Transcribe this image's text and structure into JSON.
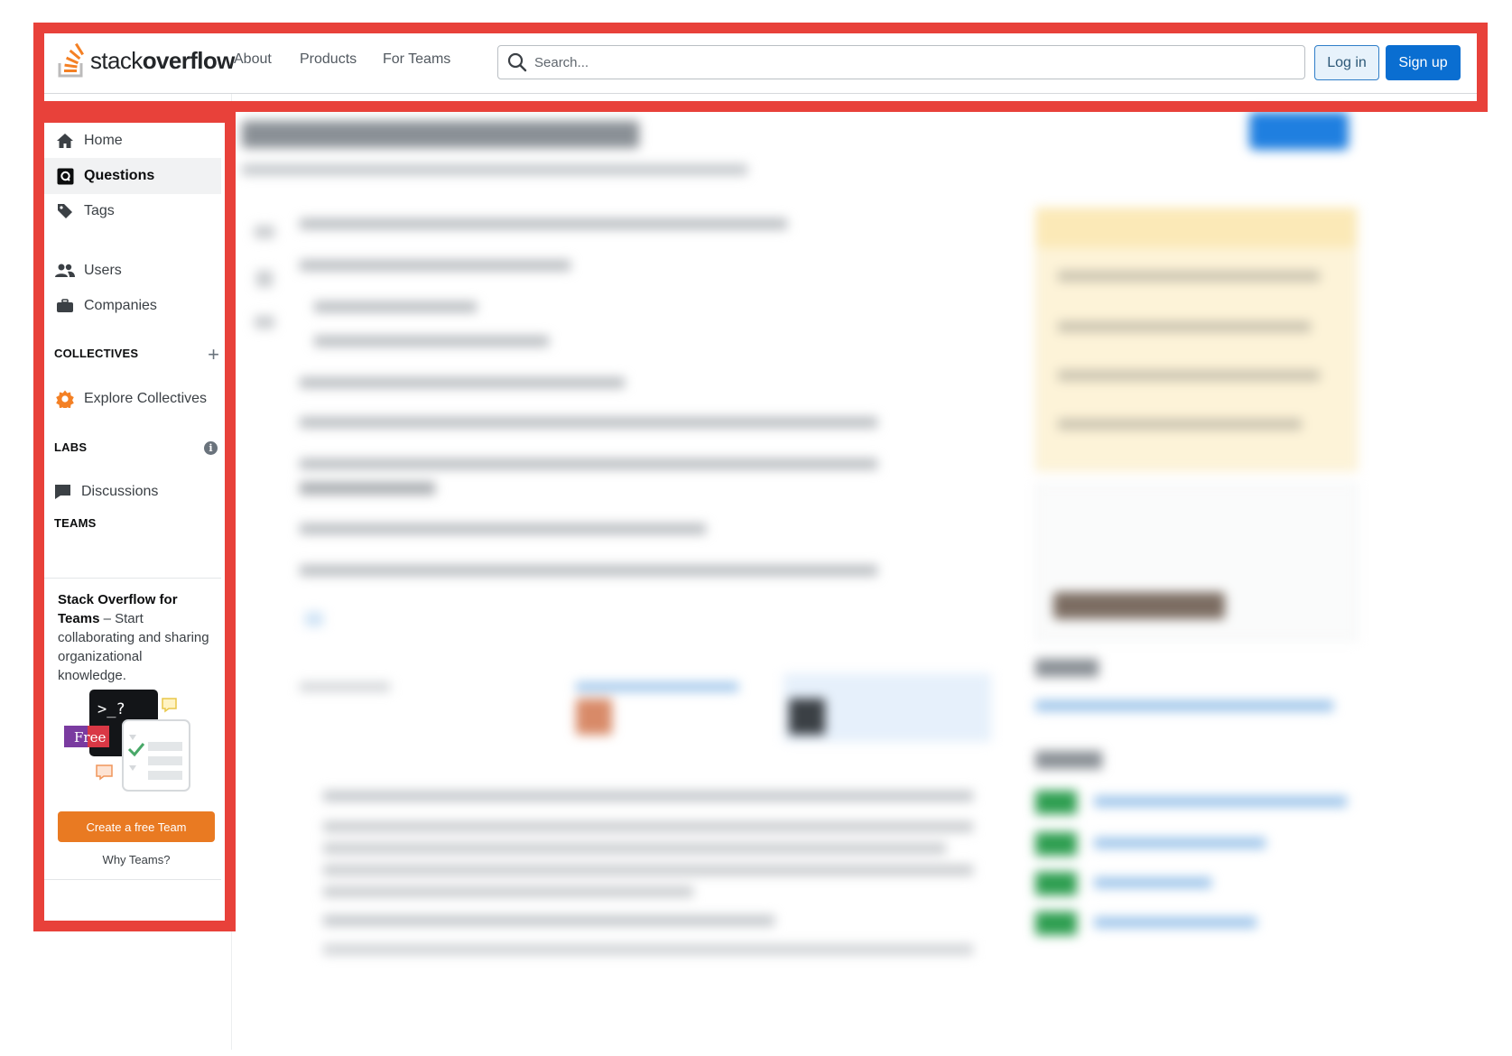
{
  "header": {
    "logo_prefix": "stack",
    "logo_bold": "overflow",
    "nav": [
      "About",
      "Products",
      "For Teams"
    ],
    "search_placeholder": "Search...",
    "login_label": "Log in",
    "signup_label": "Sign up"
  },
  "sidebar": {
    "items": [
      {
        "label": "Home",
        "icon": "home-icon"
      },
      {
        "label": "Questions",
        "icon": "questions-icon",
        "active": true
      },
      {
        "label": "Tags",
        "icon": "tag-icon"
      },
      {
        "label": "Users",
        "icon": "users-icon"
      },
      {
        "label": "Companies",
        "icon": "briefcase-icon"
      }
    ],
    "collectives_title": "COLLECTIVES",
    "explore_collectives": "Explore Collectives",
    "labs_title": "LABS",
    "discussions": "Discussions",
    "teams_title": "TEAMS",
    "teams_card": {
      "bold": "Stack Overflow for Teams",
      "text": " – Start collaborating and sharing organizational knowledge.",
      "badge": "Free",
      "terminal": ">_?",
      "cta": "Create a free Team",
      "why": "Why Teams?"
    }
  },
  "colors": {
    "accent_orange": "#e97a22",
    "primary_blue": "#0a6ed1",
    "annotation_red": "#e8413a"
  }
}
